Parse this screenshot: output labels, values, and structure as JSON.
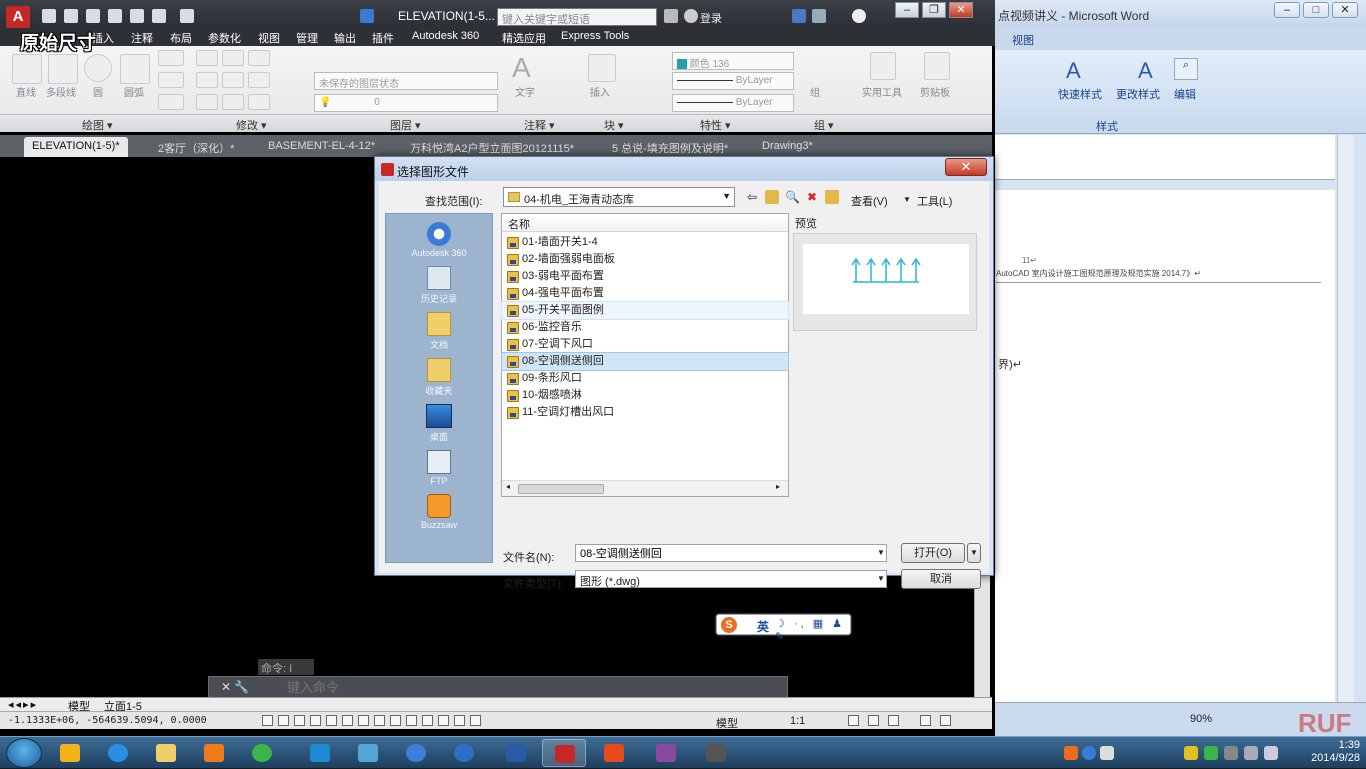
{
  "overlay_caption": "原始尺寸",
  "word": {
    "title": "点视频讲义 - Microsoft Word",
    "tab_view": "视图",
    "quick_styles": "快速样式",
    "change_styles": "更改样式",
    "editing": "编辑",
    "styles_group": "样式",
    "page_number": "11↵",
    "page_heading": "AutoCAD 室内设计施工图规范原理及规范实施 2014.7》↵",
    "page_line": "界)↵",
    "zoom": "90%"
  },
  "acad": {
    "doc_title": "ELEVATION(1-5...",
    "search_placeholder": "键入关键字或短语",
    "login": "登录",
    "menus": [
      "插入",
      "注释",
      "布局",
      "参数化",
      "视图",
      "管理",
      "输出",
      "插件",
      "Autodesk 360",
      "精选应用",
      "Express Tools"
    ],
    "ribbon": {
      "line": "直线",
      "polyline": "多段线",
      "circle": "圆",
      "arc": "圆弧",
      "layer_state": "未保存的图层状态",
      "layer_value": "0",
      "text": "文字",
      "insert": "插入",
      "color": "颜色 136",
      "linetype": "ByLayer",
      "lineweight": "ByLayer",
      "group": "组",
      "utilities": "实用工具",
      "clipboard": "剪贴板"
    },
    "ribbon_groups": [
      "绘图 ▾",
      "修改 ▾",
      "图层 ▾",
      "注释 ▾",
      "块 ▾",
      "特性 ▾",
      "组 ▾"
    ],
    "file_tabs": [
      "ELEVATION(1-5)*",
      "2客厅（深化）*",
      "BASEMENT-EL-4-12*",
      "万科悦湾A2户型立面图20121115*",
      "5 总说-填充图例及说明*",
      "Drawing3*"
    ],
    "command_history": "命令: I",
    "command_placeholder": "键入命令",
    "layout_tabs": [
      "模型",
      "立面1-5"
    ],
    "coords": "-1.1333E+06, -564639.5094, 0.0000",
    "status_model": "模型",
    "status_scale": "1:1"
  },
  "dialog": {
    "title": "选择图形文件",
    "look_in_label": "查找范围(I):",
    "look_in_value": "04-机电_王海青动态库",
    "view_menu": "查看(V)",
    "tools_menu": "工具(L)",
    "places": [
      "Autodesk 360",
      "历史记录",
      "文档",
      "收藏夹",
      "桌面",
      "FTP",
      "Buzzsaw"
    ],
    "column_name": "名称",
    "files": [
      "01-墙面开关1-4",
      "02-墙面强弱电面板",
      "03-弱电平面布置",
      "04-强电平面布置",
      "05-开关平面图例",
      "06-监控音乐",
      "07-空调下风口",
      "08-空调侧送侧回",
      "09-条形风口",
      "10-烟感喷淋",
      "11-空调灯槽出风口"
    ],
    "hovered_index": 4,
    "selected_index": 7,
    "preview_label": "预览",
    "file_name_label": "文件名(N):",
    "file_name_value": "08-空调侧送侧回",
    "file_type_label": "文件类型(T):",
    "file_type_value": "图形 (*.dwg)",
    "open_button": "打开(O)",
    "cancel_button": "取消"
  },
  "ime": {
    "mode": "英"
  },
  "taskbar": {
    "clock_time": "1:39",
    "clock_date": "2014/9/28"
  },
  "colors": {
    "acad_red": "#c62828",
    "preview_cyan": "#27b5d8",
    "selection": "#d2e5f7"
  }
}
